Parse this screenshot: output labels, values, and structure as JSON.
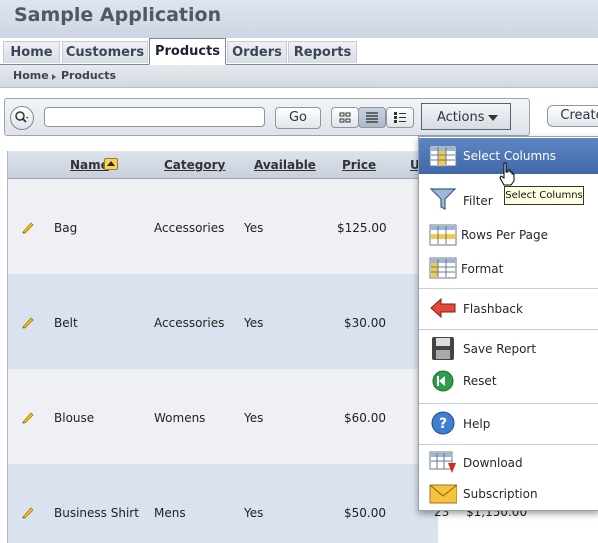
{
  "app": {
    "title": "Sample Application"
  },
  "tabs": [
    {
      "label": "Home"
    },
    {
      "label": "Customers"
    },
    {
      "label": "Products",
      "active": true
    },
    {
      "label": "Orders"
    },
    {
      "label": "Reports"
    }
  ],
  "breadcrumb": {
    "items": [
      "Home",
      "Products"
    ]
  },
  "search": {
    "value": "",
    "go_label": "Go"
  },
  "toolbar": {
    "actions_label": "Actions",
    "create_label": "Create"
  },
  "table": {
    "columns": [
      "Name",
      "Category",
      "Available",
      "Price",
      "U"
    ],
    "sorted_column": "Name",
    "rows": [
      {
        "name": "Bag",
        "category": "Accessories",
        "available": "Yes",
        "price": "$125.00"
      },
      {
        "name": "Belt",
        "category": "Accessories",
        "available": "Yes",
        "price": "$30.00"
      },
      {
        "name": "Blouse",
        "category": "Womens",
        "available": "Yes",
        "price": "$60.00"
      },
      {
        "name": "Business Shirt",
        "category": "Mens",
        "available": "Yes",
        "price": "$50.00"
      }
    ],
    "partial_cells": {
      "units": "23",
      "total": "$1,150.00"
    }
  },
  "actions_menu": {
    "items": [
      {
        "label": "Select Columns",
        "icon": "columns-icon",
        "highlighted": true
      },
      {
        "label": "Filter",
        "icon": "funnel-icon"
      },
      {
        "label": "Rows Per Page",
        "icon": "rows-icon"
      },
      {
        "label": "Format",
        "icon": "format-icon"
      },
      {
        "label": "Flashback",
        "icon": "flashback-arrow-icon"
      },
      {
        "label": "Save Report",
        "icon": "floppy-disk-icon"
      },
      {
        "label": "Reset",
        "icon": "reset-icon"
      },
      {
        "label": "Help",
        "icon": "help-icon"
      },
      {
        "label": "Download",
        "icon": "download-icon"
      },
      {
        "label": "Subscription",
        "icon": "envelope-icon"
      }
    ],
    "tooltip": "Select Columns"
  },
  "colors": {
    "menu_highlight": "#4a73b6",
    "row_alt": "#d9e2ee",
    "header_bg": "#ccd6e3"
  }
}
